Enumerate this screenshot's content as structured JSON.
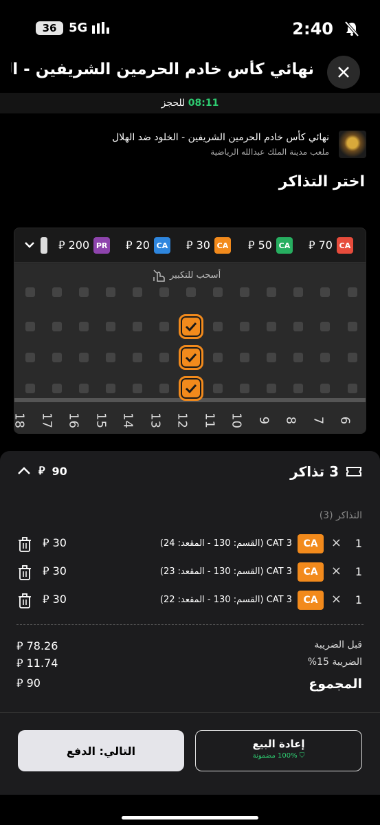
{
  "status_bar": {
    "time": "2:40",
    "battery": "36",
    "network": "5G"
  },
  "header": {
    "title": "نهائي كأس خادم الحرمين الشريفين - ال..."
  },
  "timer": {
    "value": "08:11",
    "label": "للحجز"
  },
  "event": {
    "title": "نهائي كأس خادم الحرمين الشريفين - الخلود ضد الهلال",
    "venue": "ملعب مدينة الملك عبدالله الرياضية"
  },
  "section_title": "اختر التذاكر",
  "currency": "⃁",
  "legend": [
    {
      "code": "CA",
      "price": "70",
      "color": "#e74c3c"
    },
    {
      "code": "CA",
      "price": "50",
      "color": "#27ae60"
    },
    {
      "code": "CA",
      "price": "30",
      "color": "#f28a1c"
    },
    {
      "code": "CA",
      "price": "20",
      "color": "#2e86de"
    },
    {
      "code": "PR",
      "price": "200",
      "color": "#8e44ad"
    }
  ],
  "seatmap": {
    "zoom_hint": "أسحب للتكبير",
    "row_numbers": [
      "18",
      "17",
      "16",
      "15",
      "14",
      "13",
      "12",
      "11",
      "10",
      "9",
      "8",
      "7",
      "6"
    ]
  },
  "sheet": {
    "count_label": "3 تذاكر",
    "total": "90",
    "tickets_label": "التذاكر (3)",
    "tickets": [
      {
        "qty": "1",
        "chip": "CA",
        "desc": "CAT 3 (القسم: 130 - المقعد: 24)",
        "price": "30"
      },
      {
        "qty": "1",
        "chip": "CA",
        "desc": "CAT 3 (القسم: 130 - المقعد: 23)",
        "price": "30"
      },
      {
        "qty": "1",
        "chip": "CA",
        "desc": "CAT 3 (القسم: 130 - المقعد: 22)",
        "price": "30"
      }
    ],
    "before_tax_label": "قبل الضريبة",
    "before_tax": "78.26",
    "tax_label": "الضريبة 15%",
    "tax": "11.74",
    "total_label": "المجموع",
    "grand_total": "90"
  },
  "buttons": {
    "next": "التالي: الدفع",
    "resale": "إعادة البيع",
    "resale_sub": "100% مضمونة"
  },
  "colors": {
    "accent": "#f28a1c",
    "success": "#2ecc71"
  }
}
